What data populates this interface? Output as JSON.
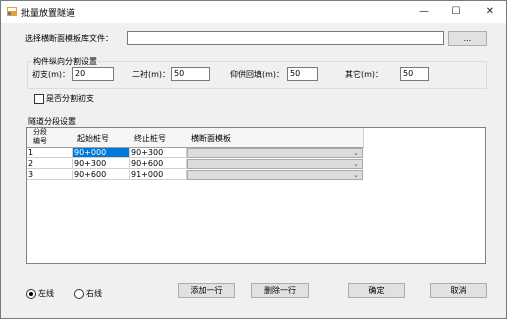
{
  "window": {
    "title": "批量放置隧道",
    "min_glyph": "—",
    "max_glyph": "☐",
    "close_glyph": "✕"
  },
  "file": {
    "label": "选择横断面模板库文件：",
    "value": "",
    "browse_label": "..."
  },
  "split": {
    "group_title": "构件纵向分割设置",
    "fields": [
      {
        "label": "初支(m)：",
        "value": "20"
      },
      {
        "label": "二衬(m)：",
        "value": "50"
      },
      {
        "label": "仰供回填(m)：",
        "value": "50"
      },
      {
        "label": "其它(m)：",
        "value": "50"
      }
    ],
    "checkbox_label": "是否分割初支",
    "checkbox_checked": false
  },
  "tunnel": {
    "group_title": "隧道分段设置",
    "headers": [
      "分段编号",
      "起始桩号",
      "终止桩号",
      "横断面模板"
    ],
    "rows": [
      {
        "no": "1",
        "start": "90+000",
        "end": "90+300",
        "template": ""
      },
      {
        "no": "2",
        "start": "90+300",
        "end": "90+600",
        "template": ""
      },
      {
        "no": "3",
        "start": "90+600",
        "end": "91+000",
        "template": ""
      }
    ]
  },
  "side": {
    "left_label": "左线",
    "right_label": "右线",
    "selected": "left"
  },
  "buttons": {
    "add": "添加一行",
    "delete": "删除一行",
    "ok": "确定",
    "cancel": "取消"
  },
  "colors": {
    "selection": "#0078d7",
    "window_bg": "#f0f0f0"
  }
}
